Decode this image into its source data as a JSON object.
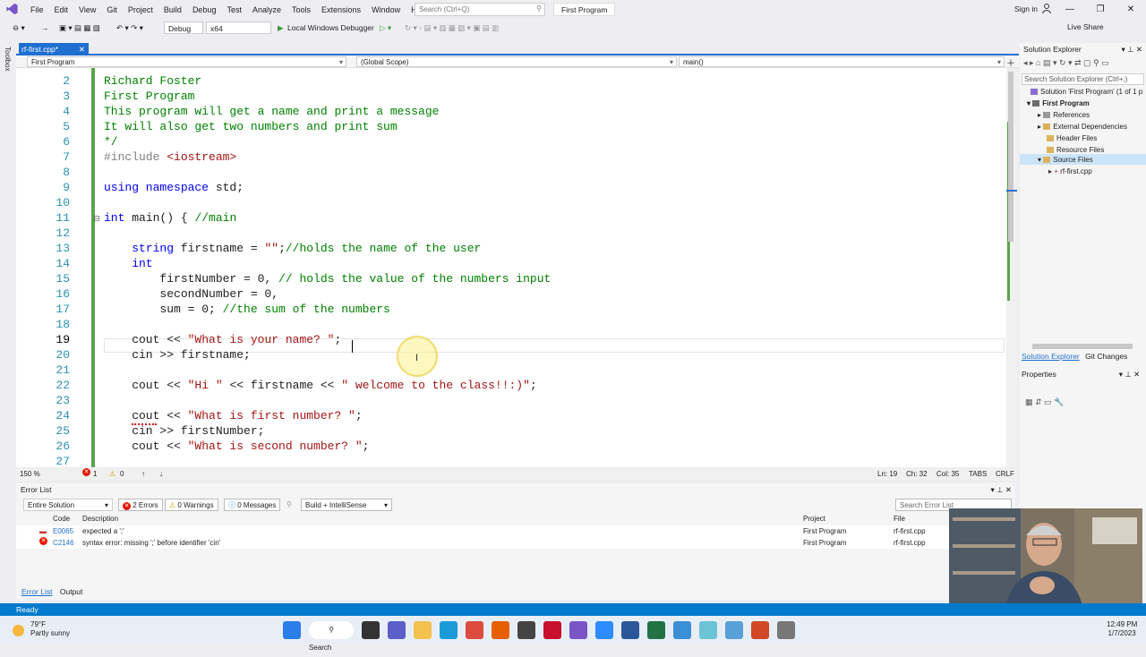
{
  "menubar": {
    "items": [
      "File",
      "Edit",
      "View",
      "Git",
      "Project",
      "Build",
      "Debug",
      "Test",
      "Analyze",
      "Tools",
      "Extensions",
      "Window",
      "Help"
    ],
    "search_placeholder": "Search (Ctrl+Q)",
    "solution_name": "First Program",
    "signin": "Sign in",
    "window_buttons": [
      "—",
      "❐",
      "✕"
    ]
  },
  "toolbar": {
    "config": "Debug",
    "platform": "x64",
    "run_label": "Local Windows Debugger",
    "live_share": "Live Share"
  },
  "toolbox_label": "Toolbox",
  "tab": {
    "name": "rf-first.cpp*",
    "close": "✕"
  },
  "navbar": {
    "project": "First Program",
    "scope": "(Global Scope)",
    "member": "main()"
  },
  "code_lines": [
    {
      "n": "2",
      "parts": [
        {
          "t": "Richard Foster",
          "c": "cm"
        }
      ]
    },
    {
      "n": "3",
      "parts": [
        {
          "t": "First Program",
          "c": "cm"
        }
      ]
    },
    {
      "n": "4",
      "parts": [
        {
          "t": "This program will get a name and print a message",
          "c": "cm"
        }
      ]
    },
    {
      "n": "5",
      "parts": [
        {
          "t": "It will also get two numbers and print sum",
          "c": "cm"
        }
      ]
    },
    {
      "n": "6",
      "parts": [
        {
          "t": "*/",
          "c": "cm"
        }
      ]
    },
    {
      "n": "7",
      "parts": [
        {
          "t": "#include ",
          "c": "pp"
        },
        {
          "t": "<iostream>",
          "c": "inc"
        }
      ]
    },
    {
      "n": "8",
      "parts": []
    },
    {
      "n": "9",
      "parts": [
        {
          "t": "using namespace ",
          "c": "kw"
        },
        {
          "t": "std;",
          "c": ""
        }
      ]
    },
    {
      "n": "10",
      "parts": []
    },
    {
      "n": "11",
      "parts": [
        {
          "t": "int ",
          "c": "kw"
        },
        {
          "t": "main() { ",
          "c": ""
        },
        {
          "t": "//main",
          "c": "cm"
        }
      ]
    },
    {
      "n": "12",
      "parts": []
    },
    {
      "n": "13",
      "parts": [
        {
          "t": "    string ",
          "c": "kw"
        },
        {
          "t": "firstname = ",
          "c": ""
        },
        {
          "t": "\"\"",
          "c": "st"
        },
        {
          "t": ";",
          "c": ""
        },
        {
          "t": "//holds the name of the user",
          "c": "cm"
        }
      ]
    },
    {
      "n": "14",
      "parts": [
        {
          "t": "    int",
          "c": "kw"
        }
      ]
    },
    {
      "n": "15",
      "parts": [
        {
          "t": "        firstNumber = 0, ",
          "c": ""
        },
        {
          "t": "// holds the value of the numbers input",
          "c": "cm"
        }
      ]
    },
    {
      "n": "16",
      "parts": [
        {
          "t": "        secondNumber = 0,",
          "c": ""
        }
      ]
    },
    {
      "n": "17",
      "parts": [
        {
          "t": "        sum = 0; ",
          "c": ""
        },
        {
          "t": "//the sum of the numbers",
          "c": "cm"
        }
      ]
    },
    {
      "n": "18",
      "parts": []
    },
    {
      "n": "19",
      "parts": [
        {
          "t": "    cout << ",
          "c": ""
        },
        {
          "t": "\"What is your name? \"",
          "c": "st"
        },
        {
          "t": ";",
          "c": ""
        }
      ]
    },
    {
      "n": "20",
      "parts": [
        {
          "t": "    cin >> firstname;",
          "c": ""
        }
      ]
    },
    {
      "n": "21",
      "parts": []
    },
    {
      "n": "22",
      "parts": [
        {
          "t": "    cout << ",
          "c": ""
        },
        {
          "t": "\"Hi \"",
          "c": "st"
        },
        {
          "t": " << firstname << ",
          "c": ""
        },
        {
          "t": "\" welcome to the class!!:)\"",
          "c": "st"
        },
        {
          "t": ";",
          "c": ""
        }
      ]
    },
    {
      "n": "23",
      "parts": []
    },
    {
      "n": "24",
      "parts": [
        {
          "t": "    cout << ",
          "c": ""
        },
        {
          "t": "\"What is first number? \"",
          "c": "st"
        },
        {
          "t": ";",
          "c": ""
        }
      ]
    },
    {
      "n": "25",
      "parts": [
        {
          "t": "    cin >> firstNumber;",
          "c": ""
        }
      ]
    },
    {
      "n": "26",
      "parts": [
        {
          "t": "    cout << ",
          "c": ""
        },
        {
          "t": "\"What is second number? \"",
          "c": "st"
        },
        {
          "t": ";",
          "c": ""
        }
      ]
    },
    {
      "n": "27",
      "parts": []
    }
  ],
  "current_line": "19",
  "editor_status": {
    "zoom": "150 %",
    "errors": "1",
    "warnings": "0",
    "line": "Ln: 19",
    "col": "Ch: 32",
    "colnum": "Col: 35",
    "tabs": "TABS",
    "eol": "CRLF"
  },
  "error_list": {
    "title": "Error List",
    "scope": "Entire Solution",
    "errors_btn": "2 Errors",
    "warnings_btn": "0 Warnings",
    "messages_btn": "0 Messages",
    "filter": "Build + IntelliSense",
    "search_placeholder": "Search Error List",
    "columns": [
      "Code",
      "Description",
      "Project",
      "File"
    ],
    "rows": [
      {
        "code": "E0065",
        "description": "expected a ';'",
        "project": "First Program",
        "file": "rf-first.cpp"
      },
      {
        "code": "C2146",
        "description": "syntax error: missing ';' before identifier 'cin'",
        "project": "First Program",
        "file": "rf-first.cpp"
      }
    ],
    "tabs": [
      "Error List",
      "Output"
    ]
  },
  "solution_explorer": {
    "title": "Solution Explorer",
    "search_placeholder": "Search Solution Explorer (Ctrl+;)",
    "items": [
      "Solution 'First Program' (1 of 1 p",
      "First Program",
      "References",
      "External Dependencies",
      "Header Files",
      "Resource Files",
      "Source Files",
      "rf-first.cpp"
    ],
    "tabs": [
      "Solution Explorer",
      "Git Changes"
    ],
    "properties": "Properties"
  },
  "statusbar": {
    "text": "Ready"
  },
  "taskbar": {
    "temp": "79°F",
    "weather": "Partly sunny",
    "search": "Search",
    "time": "12:49 PM",
    "date": "1/7/2023"
  },
  "colors": {
    "accent": "#007acc",
    "tab": "#1f6fd1",
    "comment": "#008000",
    "keyword": "#0000ff",
    "string": "#a31515"
  }
}
